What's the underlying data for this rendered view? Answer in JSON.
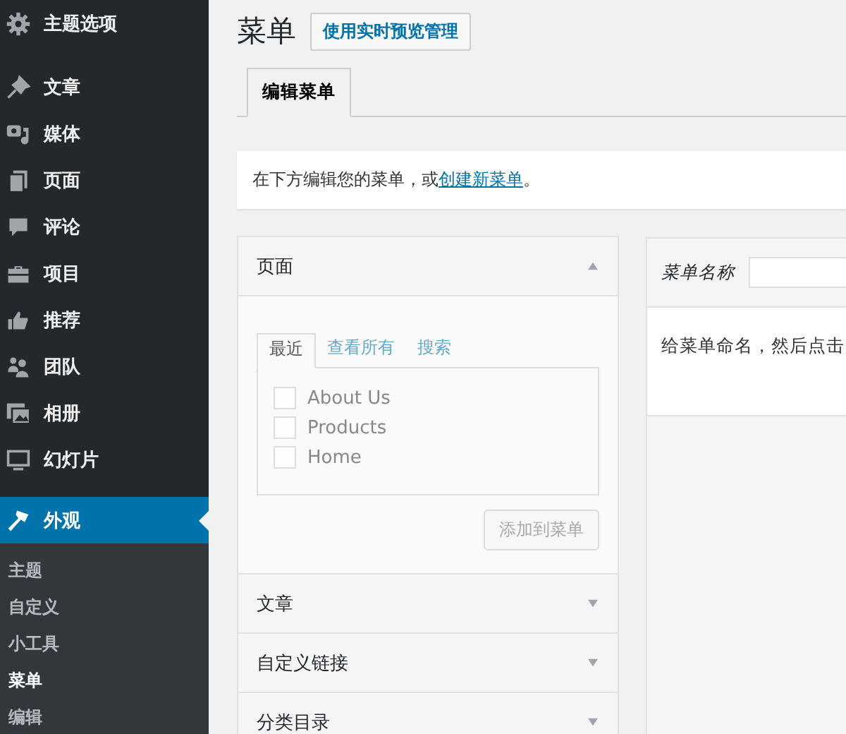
{
  "sidebar": {
    "top_item": {
      "label": "主题选项"
    },
    "items": [
      {
        "label": "文章",
        "selected": false
      },
      {
        "label": "媒体",
        "selected": false
      },
      {
        "label": "页面",
        "selected": false
      },
      {
        "label": "评论",
        "selected": false
      },
      {
        "label": "项目",
        "selected": false
      },
      {
        "label": "推荐",
        "selected": false
      },
      {
        "label": "团队",
        "selected": false
      },
      {
        "label": "相册",
        "selected": false
      },
      {
        "label": "幻灯片",
        "selected": false
      },
      {
        "label": "外观",
        "selected": true
      }
    ],
    "submenu": [
      {
        "label": "主题",
        "selected": false
      },
      {
        "label": "自定义",
        "selected": false
      },
      {
        "label": "小工具",
        "selected": false
      },
      {
        "label": "菜单",
        "selected": true
      },
      {
        "label": "编辑",
        "selected": false
      }
    ]
  },
  "page": {
    "title": "菜单",
    "header_button": "使用实时预览管理",
    "tabs": [
      {
        "label": "编辑菜单",
        "selected": true
      }
    ],
    "notice": {
      "text": "在下方编辑您的菜单，或",
      "link": "创建新菜单",
      "end": "。"
    }
  },
  "accordion": [
    {
      "title": "页面",
      "expanded": true,
      "tabs": [
        {
          "label": "最近",
          "selected": true
        },
        {
          "label": "查看所有",
          "selected": false
        },
        {
          "label": "搜索",
          "selected": false
        }
      ],
      "items": [
        {
          "label": "About Us",
          "checked": false
        },
        {
          "label": "Products",
          "checked": false
        },
        {
          "label": "Home",
          "checked": false
        }
      ],
      "button": {
        "label": "添加到菜单",
        "disabled": true
      }
    },
    {
      "title": "文章",
      "expanded": false
    },
    {
      "title": "自定义链接",
      "expanded": false
    },
    {
      "title": "分类目录",
      "expanded": false
    }
  ],
  "menu_panel": {
    "name_label": "菜单名称",
    "body_text": "给菜单命名，然后点击"
  }
}
